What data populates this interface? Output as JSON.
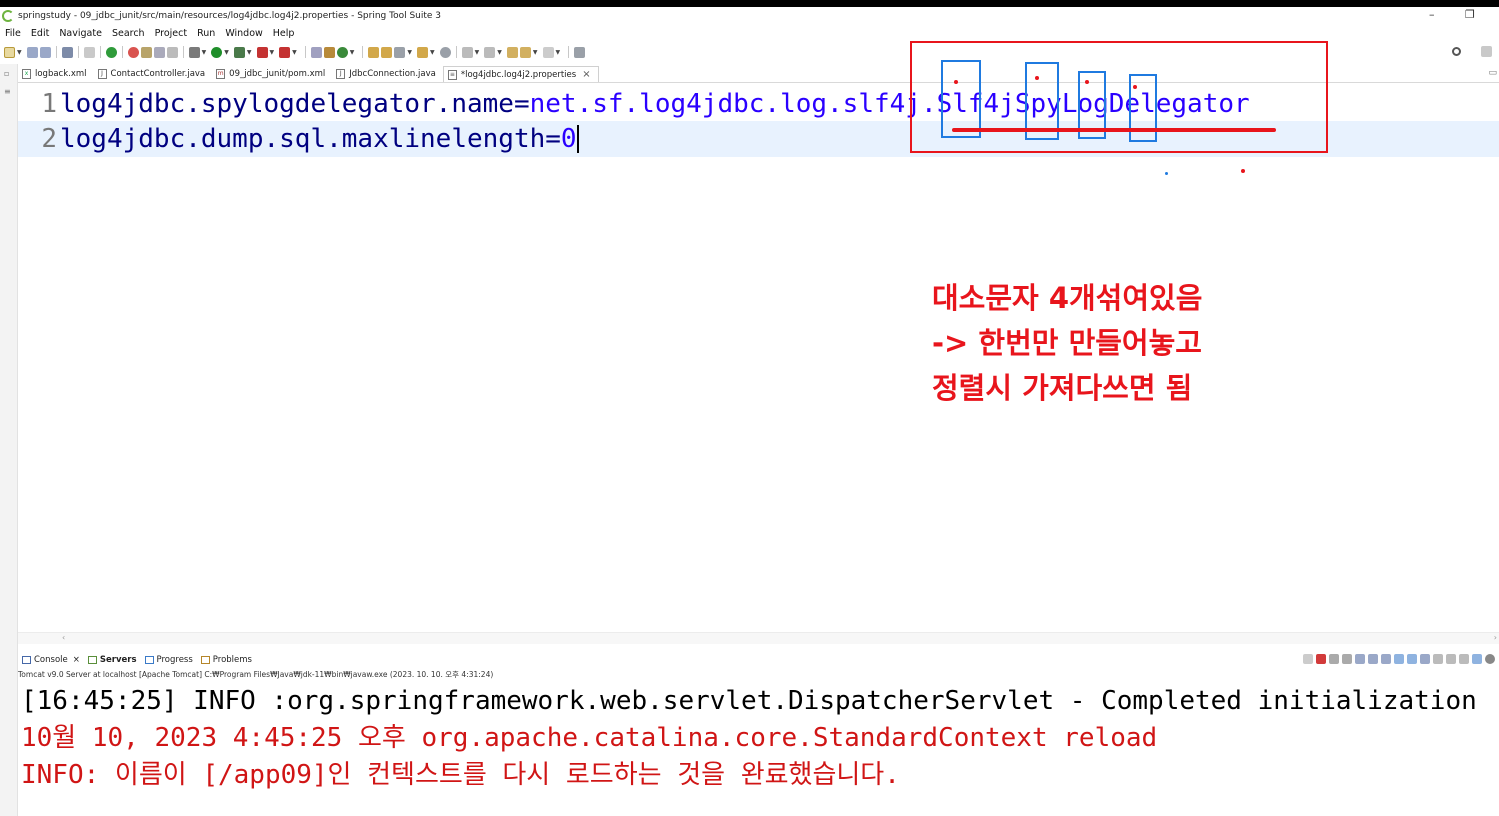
{
  "window": {
    "title": "springstudy - 09_jdbc_junit/src/main/resources/log4jdbc.log4j2.properties - Spring Tool Suite 3",
    "minimize": "–",
    "restore": "❐"
  },
  "menu": [
    "File",
    "Edit",
    "Navigate",
    "Search",
    "Project",
    "Run",
    "Window",
    "Help"
  ],
  "tabs": [
    {
      "label": "logback.xml",
      "icon": "xml-file-icon",
      "active": false
    },
    {
      "label": "ContactController.java",
      "icon": "java-file-icon",
      "active": false
    },
    {
      "label": "09_jdbc_junit/pom.xml",
      "icon": "maven-pom-icon",
      "active": false
    },
    {
      "label": "JdbcConnection.java",
      "icon": "java-file-icon",
      "active": false
    },
    {
      "label": "*log4jdbc.log4j2.properties",
      "icon": "properties-file-icon",
      "active": true
    }
  ],
  "editor": {
    "lines": [
      {
        "num": "1",
        "key": "log4jdbc.spylogdelegator.name=",
        "value": "net.sf.log4jdbc.log.slf4j.Slf4jSpyLogDelegator"
      },
      {
        "num": "2",
        "key": "log4jdbc.dump.sql.maxlinelength=",
        "value": "0"
      }
    ]
  },
  "annotation": {
    "line1": "대소문자 4개섞여있음",
    "line2": "-> 한번만 만들어놓고",
    "line3": "정렬시 가져다쓰면 됨",
    "color": "#e8151c"
  },
  "console_tabs": [
    {
      "label": "Console",
      "bold": false,
      "closable": true
    },
    {
      "label": "Servers",
      "bold": true,
      "closable": false
    },
    {
      "label": "Progress",
      "bold": false,
      "closable": false
    },
    {
      "label": "Problems",
      "bold": false,
      "closable": false
    }
  ],
  "console": {
    "process": "Tomcat v9.0 Server at localhost [Apache Tomcat] C:₩Program Files₩Java₩jdk-11₩bin₩javaw.exe  (2023. 10. 10. 오후 4:31:24)",
    "lines": [
      {
        "text": "[16:45:25] INFO :org.springframework.web.servlet.DispatcherServlet - Completed initialization",
        "type": "info"
      },
      {
        "text": "10월 10, 2023 4:45:25 오후 org.apache.catalina.core.StandardContext reload",
        "type": "err"
      },
      {
        "text": "INFO: 이름이 [/app09]인 컨텍스트를 다시 로드하는 것을 완료했습니다.",
        "type": "err"
      }
    ]
  }
}
